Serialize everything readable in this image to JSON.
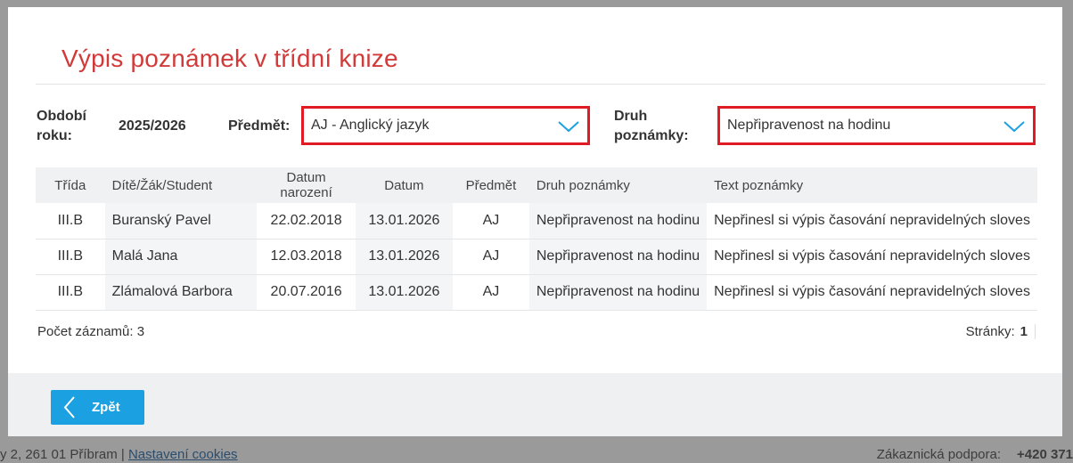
{
  "background_footer": {
    "address": "y 2, 261 01 Příbram | ",
    "cookies_link": "Nastavení cookies",
    "support_label": "Zákaznická podpora:",
    "support_phone": "+420 371"
  },
  "modal": {
    "title": "Výpis poznámek v třídní knize",
    "filters": {
      "period_label_line1": "Období",
      "period_label_line2": "roku:",
      "period_value": "2025/2026",
      "subject_label": "Předmět:",
      "subject_value": "AJ - Anglický jazyk",
      "note_type_label_line1": "Druh",
      "note_type_label_line2": "poznámky:",
      "note_type_value": "Nepřipravenost na hodinu"
    },
    "table": {
      "columns": [
        "Třída",
        "Dítě/Žák/Student",
        "Datum narození",
        "Datum",
        "Předmět",
        "Druh poznámky",
        "Text poznámky"
      ],
      "rows": [
        [
          "III.B",
          "Buranský Pavel",
          "22.02.2018",
          "13.01.2026",
          "AJ",
          "Nepřipravenost na hodinu",
          "Nepřinesl si výpis časování nepravidelných sloves"
        ],
        [
          "III.B",
          "Malá Jana",
          "12.03.2018",
          "13.01.2026",
          "AJ",
          "Nepřipravenost na hodinu",
          "Nepřinesl si výpis časování nepravidelných sloves"
        ],
        [
          "III.B",
          "Zlámalová Barbora",
          "20.07.2016",
          "13.01.2026",
          "AJ",
          "Nepřipravenost na hodinu",
          "Nepřinesl si výpis časování nepravidelných sloves"
        ]
      ]
    },
    "record_count": "Počet záznamů: 3",
    "pages_label": "Stránky:",
    "pages_current": "1",
    "back_button": "Zpět"
  },
  "colors": {
    "title_red": "#d23a3a",
    "highlight_red": "#e01b24",
    "accent_blue": "#1ba1e2"
  },
  "icons": [
    "chevron-down-icon",
    "chevron-left-icon"
  ]
}
